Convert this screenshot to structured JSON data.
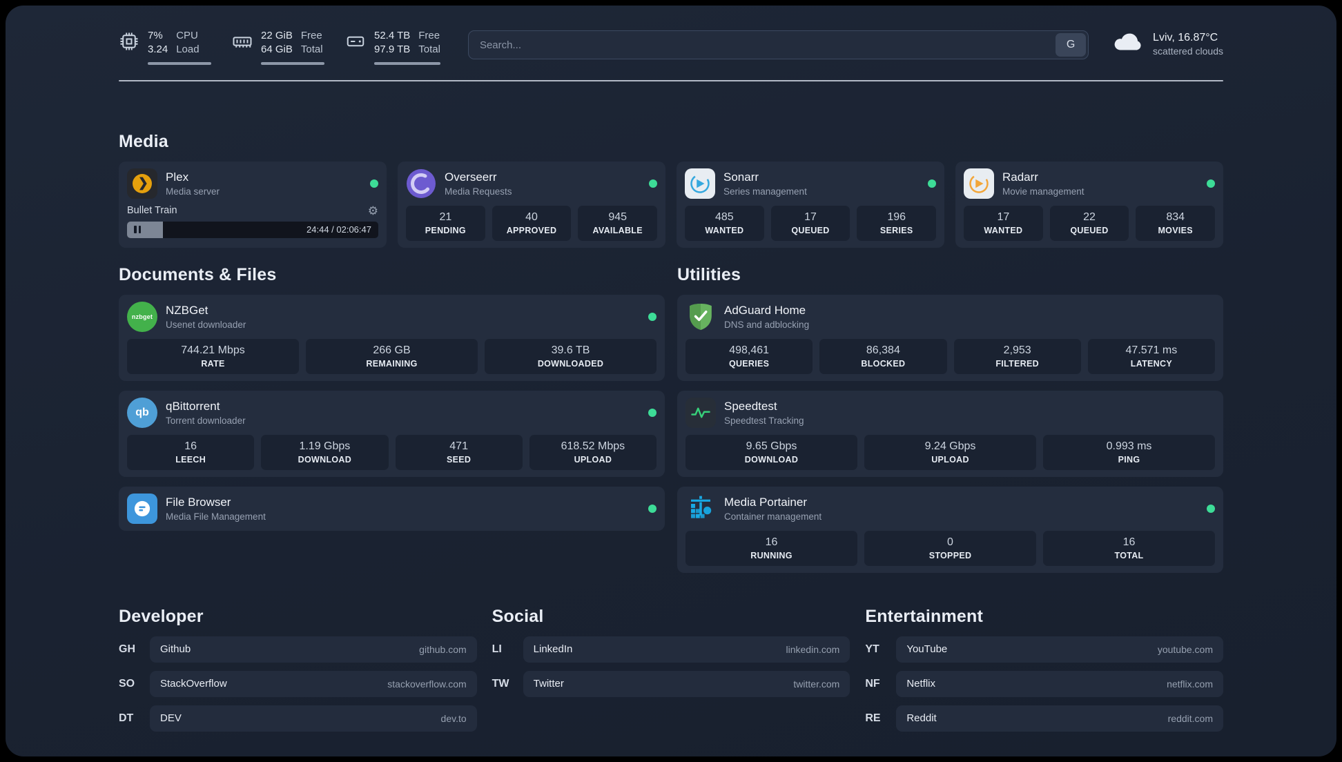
{
  "colors": {
    "background": "#1a2231",
    "card": "#242d3e",
    "stat_box": "#1a2231",
    "status_online": "#3ddc97",
    "accent_plex": "#e5a00d",
    "accent_sonarr": "#35a8de",
    "accent_radarr": "#f2a63a",
    "accent_adguard": "#67b35f",
    "accent_portainer": "#18a9e4"
  },
  "icons": {
    "gear": "⚙"
  },
  "topbar": {
    "cpu": {
      "value_top": "7%",
      "value_bottom": "3.24",
      "label_top": "CPU",
      "label_bottom": "Load"
    },
    "memory": {
      "value_top": "22 GiB",
      "value_bottom": "64 GiB",
      "label_top": "Free",
      "label_bottom": "Total"
    },
    "disk": {
      "value_top": "52.4 TB",
      "value_bottom": "97.9 TB",
      "label_top": "Free",
      "label_bottom": "Total"
    },
    "search": {
      "placeholder": "Search...",
      "provider_button": "G"
    },
    "weather": {
      "location": "Lviv, 16.87°C",
      "condition": "scattered clouds"
    }
  },
  "sections": {
    "media": {
      "title": "Media",
      "plex": {
        "name": "Plex",
        "desc": "Media server",
        "now_playing": "Bullet Train",
        "time": "24:44 / 02:06:47"
      },
      "overseerr": {
        "name": "Overseerr",
        "desc": "Media Requests",
        "stats": [
          {
            "v": "21",
            "l": "PENDING"
          },
          {
            "v": "40",
            "l": "APPROVED"
          },
          {
            "v": "945",
            "l": "AVAILABLE"
          }
        ]
      },
      "sonarr": {
        "name": "Sonarr",
        "desc": "Series management",
        "stats": [
          {
            "v": "485",
            "l": "WANTED"
          },
          {
            "v": "17",
            "l": "QUEUED"
          },
          {
            "v": "196",
            "l": "SERIES"
          }
        ]
      },
      "radarr": {
        "name": "Radarr",
        "desc": "Movie management",
        "stats": [
          {
            "v": "17",
            "l": "WANTED"
          },
          {
            "v": "22",
            "l": "QUEUED"
          },
          {
            "v": "834",
            "l": "MOVIES"
          }
        ]
      }
    },
    "documents": {
      "title": "Documents & Files",
      "nzbget": {
        "name": "NZBGet",
        "desc": "Usenet downloader",
        "icon_text": "nzbget",
        "stats": [
          {
            "v": "744.21 Mbps",
            "l": "RATE"
          },
          {
            "v": "266 GB",
            "l": "REMAINING"
          },
          {
            "v": "39.6 TB",
            "l": "DOWNLOADED"
          }
        ]
      },
      "qbittorrent": {
        "name": "qBittorrent",
        "desc": "Torrent downloader",
        "icon_text": "qb",
        "stats": [
          {
            "v": "16",
            "l": "LEECH"
          },
          {
            "v": "1.19 Gbps",
            "l": "DOWNLOAD"
          },
          {
            "v": "471",
            "l": "SEED"
          },
          {
            "v": "618.52 Mbps",
            "l": "UPLOAD"
          }
        ]
      },
      "filebrowser": {
        "name": "File Browser",
        "desc": "Media File Management"
      }
    },
    "utilities": {
      "title": "Utilities",
      "adguard": {
        "name": "AdGuard Home",
        "desc": "DNS and adblocking",
        "stats": [
          {
            "v": "498,461",
            "l": "QUERIES"
          },
          {
            "v": "86,384",
            "l": "BLOCKED"
          },
          {
            "v": "2,953",
            "l": "FILTERED"
          },
          {
            "v": "47.571 ms",
            "l": "LATENCY"
          }
        ]
      },
      "speedtest": {
        "name": "Speedtest",
        "desc": "Speedtest Tracking",
        "stats": [
          {
            "v": "9.65 Gbps",
            "l": "DOWNLOAD"
          },
          {
            "v": "9.24 Gbps",
            "l": "UPLOAD"
          },
          {
            "v": "0.993 ms",
            "l": "PING"
          }
        ]
      },
      "portainer": {
        "name": "Media Portainer",
        "desc": "Container management",
        "stats": [
          {
            "v": "16",
            "l": "RUNNING"
          },
          {
            "v": "0",
            "l": "STOPPED"
          },
          {
            "v": "16",
            "l": "TOTAL"
          }
        ]
      }
    },
    "bookmarks": {
      "developer": {
        "title": "Developer",
        "items": [
          {
            "abbr": "GH",
            "name": "Github",
            "href": "github.com"
          },
          {
            "abbr": "SO",
            "name": "StackOverflow",
            "href": "stackoverflow.com"
          },
          {
            "abbr": "DT",
            "name": "DEV",
            "href": "dev.to"
          }
        ]
      },
      "social": {
        "title": "Social",
        "items": [
          {
            "abbr": "LI",
            "name": "LinkedIn",
            "href": "linkedin.com"
          },
          {
            "abbr": "TW",
            "name": "Twitter",
            "href": "twitter.com"
          }
        ]
      },
      "entertainment": {
        "title": "Entertainment",
        "items": [
          {
            "abbr": "YT",
            "name": "YouTube",
            "href": "youtube.com"
          },
          {
            "abbr": "NF",
            "name": "Netflix",
            "href": "netflix.com"
          },
          {
            "abbr": "RE",
            "name": "Reddit",
            "href": "reddit.com"
          }
        ]
      }
    }
  }
}
